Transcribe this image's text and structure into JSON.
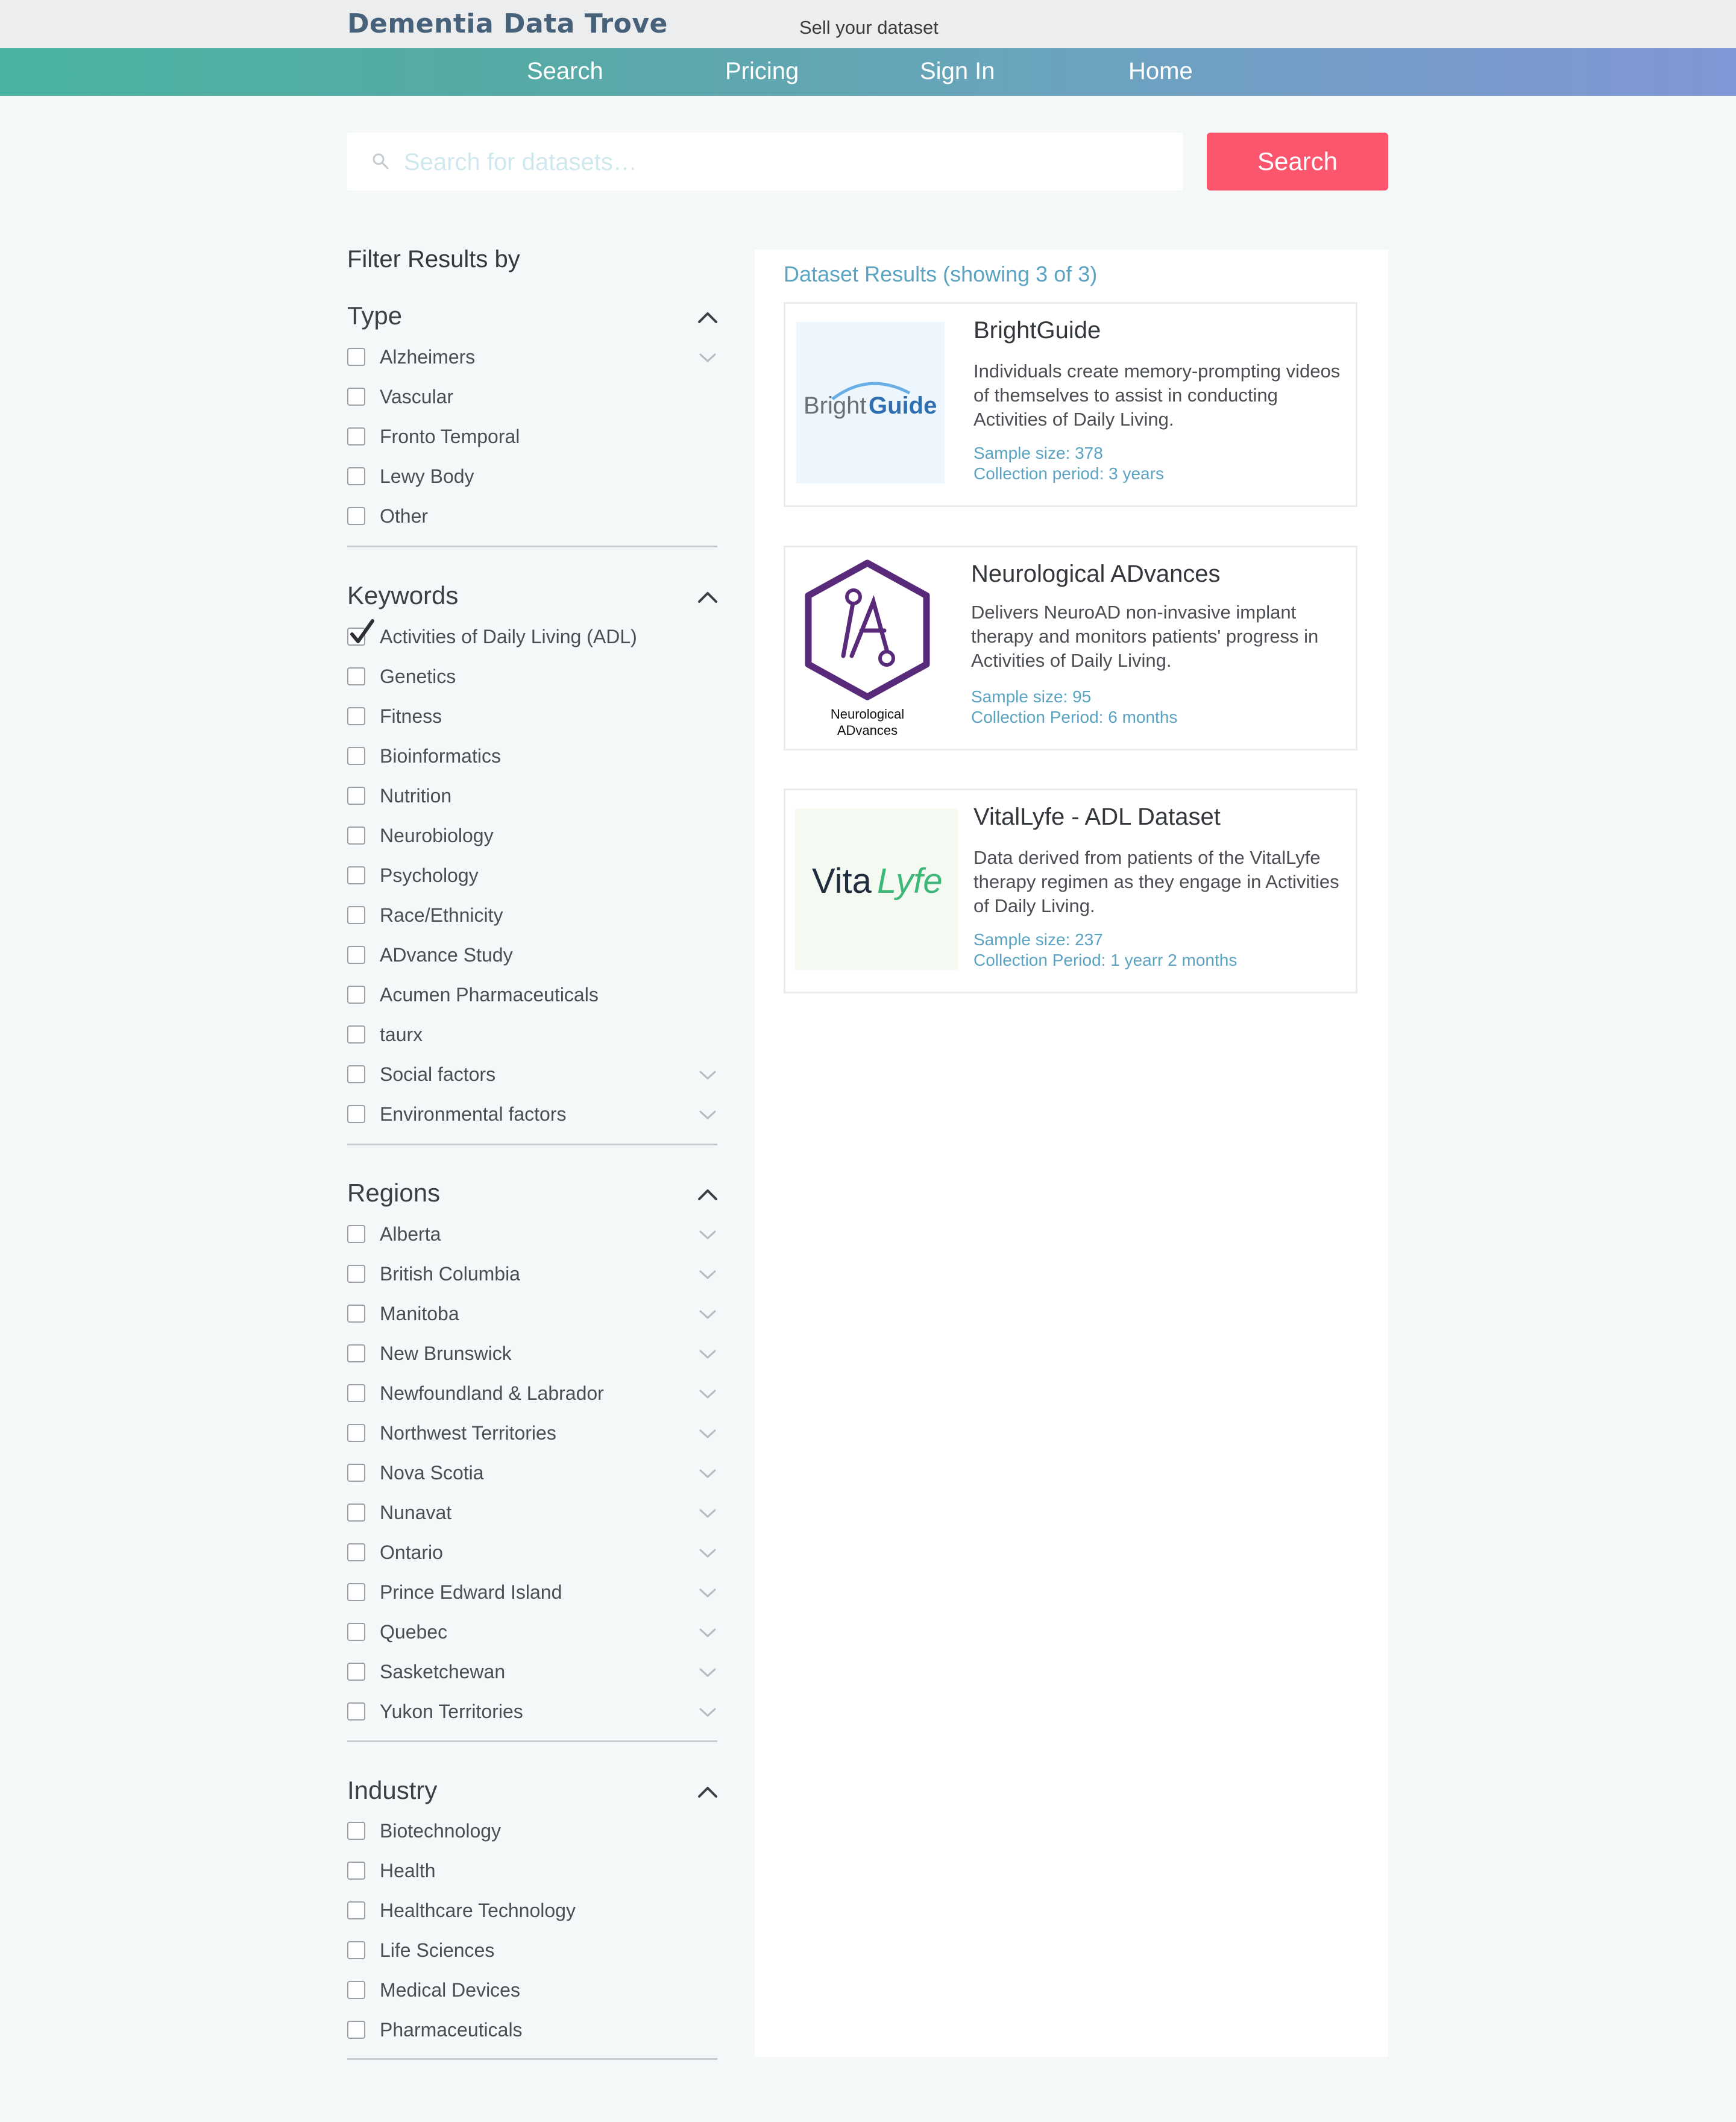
{
  "header": {
    "brand": "Dementia Data Trove",
    "sell_link": "Sell your dataset"
  },
  "nav": {
    "items": [
      {
        "label": "Search"
      },
      {
        "label": "Pricing"
      },
      {
        "label": "Sign In"
      },
      {
        "label": "Home"
      }
    ]
  },
  "search": {
    "placeholder": "Search for datasets…",
    "value": "",
    "button_label": "Search"
  },
  "filters": {
    "title": "Filter Results by",
    "sections": [
      {
        "title": "Type",
        "options": [
          {
            "label": "Alzheimers",
            "checked": false,
            "expandable": true
          },
          {
            "label": "Vascular",
            "checked": false,
            "expandable": false
          },
          {
            "label": "Fronto Temporal",
            "checked": false,
            "expandable": false
          },
          {
            "label": "Lewy Body",
            "checked": false,
            "expandable": false
          },
          {
            "label": "Other",
            "checked": false,
            "expandable": false
          }
        ]
      },
      {
        "title": "Keywords",
        "options": [
          {
            "label": "Activities of Daily Living (ADL)",
            "checked": true,
            "expandable": false
          },
          {
            "label": "Genetics",
            "checked": false,
            "expandable": false
          },
          {
            "label": "Fitness",
            "checked": false,
            "expandable": false
          },
          {
            "label": "Bioinformatics",
            "checked": false,
            "expandable": false
          },
          {
            "label": "Nutrition",
            "checked": false,
            "expandable": false
          },
          {
            "label": "Neurobiology",
            "checked": false,
            "expandable": false
          },
          {
            "label": "Psychology",
            "checked": false,
            "expandable": false
          },
          {
            "label": "Race/Ethnicity",
            "checked": false,
            "expandable": false
          },
          {
            "label": "ADvance Study",
            "checked": false,
            "expandable": false
          },
          {
            "label": "Acumen Pharmaceuticals",
            "checked": false,
            "expandable": false
          },
          {
            "label": "taurx",
            "checked": false,
            "expandable": false
          },
          {
            "label": "Social factors",
            "checked": false,
            "expandable": true
          },
          {
            "label": "Environmental factors",
            "checked": false,
            "expandable": true
          }
        ]
      },
      {
        "title": "Regions",
        "options": [
          {
            "label": "Alberta",
            "checked": false,
            "expandable": true
          },
          {
            "label": "British Columbia",
            "checked": false,
            "expandable": true
          },
          {
            "label": "Manitoba",
            "checked": false,
            "expandable": true
          },
          {
            "label": "New Brunswick",
            "checked": false,
            "expandable": true
          },
          {
            "label": "Newfoundland & Labrador",
            "checked": false,
            "expandable": true
          },
          {
            "label": "Northwest Territories",
            "checked": false,
            "expandable": true
          },
          {
            "label": "Nova Scotia",
            "checked": false,
            "expandable": true
          },
          {
            "label": "Nunavat",
            "checked": false,
            "expandable": true
          },
          {
            "label": "Ontario",
            "checked": false,
            "expandable": true
          },
          {
            "label": "Prince Edward Island",
            "checked": false,
            "expandable": true
          },
          {
            "label": "Quebec",
            "checked": false,
            "expandable": true
          },
          {
            "label": "Sasketchewan",
            "checked": false,
            "expandable": true
          },
          {
            "label": "Yukon Territories",
            "checked": false,
            "expandable": true
          }
        ]
      },
      {
        "title": "Industry",
        "options": [
          {
            "label": "Biotechnology",
            "checked": false,
            "expandable": false
          },
          {
            "label": "Health",
            "checked": false,
            "expandable": false
          },
          {
            "label": "Healthcare Technology",
            "checked": false,
            "expandable": false
          },
          {
            "label": "Life Sciences",
            "checked": false,
            "expandable": false
          },
          {
            "label": "Medical Devices",
            "checked": false,
            "expandable": false
          },
          {
            "label": "Pharmaceuticals",
            "checked": false,
            "expandable": false
          }
        ]
      }
    ]
  },
  "results": {
    "heading": "Dataset Results (showing 3 of 3)",
    "datasets": [
      {
        "title": "BrightGuide",
        "description": "Individuals create memory-prompting videos of themselves to assist in conducting Activities of Daily Living.",
        "sample_size": "Sample size: 378",
        "collection_period": "Collection period: 3 years",
        "logo_text_1": "Bright",
        "logo_text_2": "Guide"
      },
      {
        "title": "Neurological ADvances",
        "description": "Delivers NeuroAD non-invasive implant therapy and monitors patients' progress in Activities of Daily Living.",
        "sample_size": "Sample size: 95",
        "collection_period": "Collection Period: 6 months",
        "logo_text_1": "Neurological",
        "logo_text_2": "ADvances"
      },
      {
        "title": "VitalLyfe - ADL Dataset",
        "description": "Data derived from patients of the VitalLyfe therapy regimen as they engage in Activities of Daily Living.",
        "sample_size": "Sample size: 237",
        "collection_period": "Collection Period: 1 yearr 2 months",
        "logo_text_1": "Vita",
        "logo_text_2": "Lyfe"
      }
    ]
  },
  "colors": {
    "brand": "#48617a",
    "accent_button": "#fb566d",
    "link_blue": "#5ba3c2",
    "nav_gradient_start": "#4bb3a1",
    "nav_gradient_end": "#8196d6",
    "neuro_purple": "#5a2a7a",
    "vita_green": "#3db879",
    "brightguide_blue": "#2f6fb0"
  }
}
